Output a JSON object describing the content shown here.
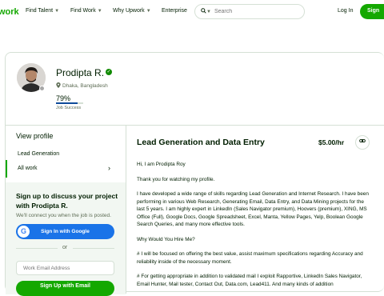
{
  "header": {
    "logo": "work",
    "nav": [
      "Find Talent",
      "Find Work",
      "Why Upwork",
      "Enterprise"
    ],
    "search_placeholder": "Search",
    "login": "Log In",
    "signup": "Sign"
  },
  "profile": {
    "name": "Prodipta R.",
    "location": "Dhaka, Bangladesh",
    "job_success": "79%",
    "job_success_fraction": 0.79,
    "job_success_label": "Job Success"
  },
  "sidebar": {
    "view_profile": "View profile",
    "items": [
      "Lead Generation",
      "All work"
    ]
  },
  "signup_panel": {
    "title": "Sign up to discuss your project with Prodipta R.",
    "subtitle": "We'll connect you when the job is posted.",
    "google_button": "Sign In with Google",
    "or": "or",
    "email_placeholder": "Work Email Address",
    "email_button": "Sign Up with Email"
  },
  "job": {
    "title": "Lead Generation and Data Entry",
    "rate": "$5.00/hr",
    "paragraphs": [
      "Hi, I am Prodipta Roy",
      "Thank you for watching my profile.",
      "I have developed a wide range of skills regarding Lead Generation and Internet Research. I have been performing in various Web Research, Generating Email, Data Entry, and Data Mining projects for the last 5 years. I am highly expert in LinkedIn (Sales Navigator premium), Hoovers (premium), XING, MS Office (Full), Google Docs, Google Spreadsheet, Excel, Manta, Yellow Pages, Yelp, Boolean Google Search Queries, and many more effective tools.",
      "Why Would You Hire Me?",
      "# I will be focused on offering the best value, assist maximum specifications regarding Accuracy and reliability inside of the necessary moment.",
      "# For getting appropriate in addition to validated mail I exploit Rapportive, LinkedIn Sales Navigator, Email Hunter, Mail tester, Contact Out, Data.com, Lead411. And many kinds of addition"
    ]
  },
  "colors": {
    "brand": "#14a800",
    "google": "#1a73e8",
    "jss": "#0f4b9a"
  }
}
